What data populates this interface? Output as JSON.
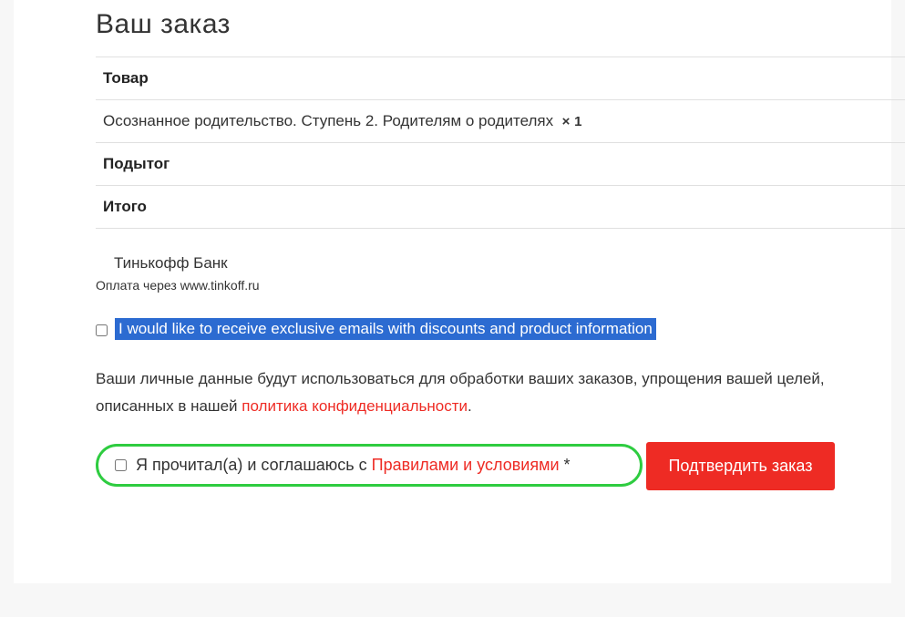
{
  "heading": "Ваш заказ",
  "table": {
    "header_product": "Товар",
    "product_name": "Осознанное родительство. Ступень 2. Родителям о родителях",
    "product_qty_sep": "×",
    "product_qty": "1",
    "subtotal_label": "Подытог",
    "total_label": "Итого"
  },
  "payment": {
    "method": "Тинькофф Банк",
    "note": "Оплата через www.tinkoff.ru"
  },
  "newsletter": {
    "label": "I would like to receive exclusive emails with discounts and product information"
  },
  "privacy": {
    "text_before": "Ваши личные данные будут использоваться для обработки ваших заказов, упрощения вашей целей, описанных в нашей ",
    "link": "политика конфиденциальности",
    "text_after": "."
  },
  "terms": {
    "text_before": "Я прочитал(а) и соглашаюсь с ",
    "link": "Правилами и условиями",
    "required": " *"
  },
  "submit_label": "Подтвердить заказ"
}
